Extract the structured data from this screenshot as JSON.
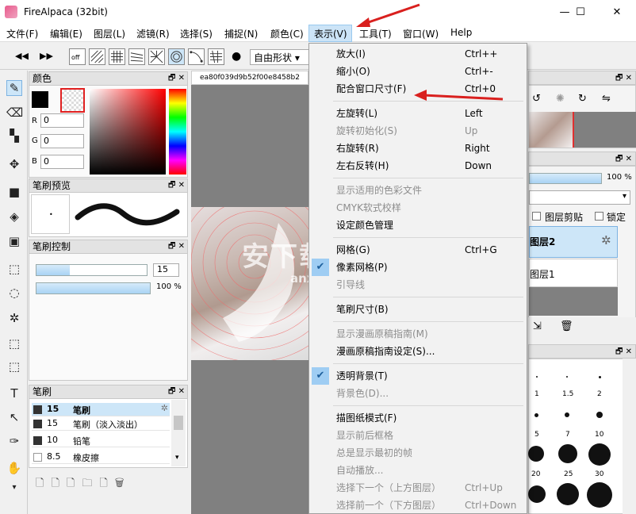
{
  "window": {
    "title": "FireAlpaca (32bit)",
    "minimize": "—",
    "maximize": "☐",
    "close": "✕"
  },
  "menubar": {
    "items": [
      "文件(F)",
      "编辑(E)",
      "图层(L)",
      "滤镜(R)",
      "选择(S)",
      "捕捉(N)",
      "颜色(C)",
      "表示(V)",
      "工具(T)",
      "窗口(W)",
      "Help"
    ]
  },
  "toolbar": {
    "shape_select": "自由形状 ▾",
    "off_label": "off"
  },
  "panels": {
    "color": {
      "title": "颜色",
      "r_label": "R",
      "g_label": "G",
      "b_label": "B",
      "r": "0",
      "g": "0",
      "b": "0"
    },
    "brush_preview": {
      "title": "笔刷预览"
    },
    "brush_control": {
      "title": "笔刷控制",
      "size": "15",
      "opacity": "100 %"
    },
    "brush": {
      "title": "笔刷",
      "items": [
        {
          "size": "15",
          "name": "笔刷",
          "selected": true
        },
        {
          "size": "15",
          "name": "笔刷（淡入淡出）",
          "selected": false
        },
        {
          "size": "10",
          "name": "铅笔",
          "selected": false
        },
        {
          "size": "8.5",
          "name": "橡皮擦",
          "selected": false
        }
      ]
    },
    "layer": {
      "opacity": "100 %",
      "clip_label": "图层剪贴",
      "lock_label": "锁定",
      "layer2": "图层2",
      "layer1": "图层1"
    },
    "brush_sizes": {
      "labels": [
        "1",
        "1.5",
        "2",
        "5",
        "7",
        "10",
        "20",
        "25",
        "30"
      ]
    }
  },
  "canvas": {
    "tab_label": "ea80f039d9b52f00e8458b2"
  },
  "watermark": {
    "line1": "安下载",
    "line2": "anxz.com"
  },
  "view_menu": {
    "items": [
      {
        "label": "放大(I)",
        "shortcut": "Ctrl++",
        "disabled": false,
        "checked": false
      },
      {
        "label": "缩小(O)",
        "shortcut": "Ctrl+-",
        "disabled": false,
        "checked": false
      },
      {
        "label": "配合窗口尺寸(F)",
        "shortcut": "Ctrl+0",
        "disabled": false,
        "checked": false
      },
      {
        "label": "左旋转(L)",
        "shortcut": "Left",
        "disabled": false,
        "checked": false
      },
      {
        "label": "旋转初始化(S)",
        "shortcut": "Up",
        "disabled": true,
        "checked": false
      },
      {
        "label": "右旋转(R)",
        "shortcut": "Right",
        "disabled": false,
        "checked": false
      },
      {
        "label": "左右反转(H)",
        "shortcut": "Down",
        "disabled": false,
        "checked": false
      },
      {
        "label": "显示适用的色彩文件",
        "shortcut": "",
        "disabled": true,
        "checked": false
      },
      {
        "label": "CMYK软式校样",
        "shortcut": "",
        "disabled": true,
        "checked": false
      },
      {
        "label": "设定颜色管理",
        "shortcut": "",
        "disabled": false,
        "checked": false
      },
      {
        "label": "网格(G)",
        "shortcut": "Ctrl+G",
        "disabled": false,
        "checked": false
      },
      {
        "label": "像素网格(P)",
        "shortcut": "",
        "disabled": false,
        "checked": true
      },
      {
        "label": "引导线",
        "shortcut": "",
        "disabled": true,
        "checked": false
      },
      {
        "label": "笔刷尺寸(B)",
        "shortcut": "",
        "disabled": false,
        "checked": false
      },
      {
        "label": "显示漫画原稿指南(M)",
        "shortcut": "",
        "disabled": true,
        "checked": false
      },
      {
        "label": "漫画原稿指南设定(S)...",
        "shortcut": "",
        "disabled": false,
        "checked": false
      },
      {
        "label": "透明背景(T)",
        "shortcut": "",
        "disabled": false,
        "checked": true
      },
      {
        "label": "背景色(D)...",
        "shortcut": "",
        "disabled": true,
        "checked": false
      },
      {
        "label": "描图纸模式(F)",
        "shortcut": "",
        "disabled": false,
        "checked": false
      },
      {
        "label": "显示前后框格",
        "shortcut": "",
        "disabled": true,
        "checked": false
      },
      {
        "label": "总是显示最初的帧",
        "shortcut": "",
        "disabled": true,
        "checked": false
      },
      {
        "label": "自动播放...",
        "shortcut": "",
        "disabled": true,
        "checked": false
      },
      {
        "label": "选择下一个（上方图层）",
        "shortcut": "Ctrl+Up",
        "disabled": true,
        "checked": false
      },
      {
        "label": "选择前一个（下方图层）",
        "shortcut": "Ctrl+Down",
        "disabled": true,
        "checked": false
      }
    ]
  },
  "colors": {
    "arrow": "#d9201e",
    "menu_highlight": "#cce4f7",
    "check_bg": "#9fcdf3"
  }
}
